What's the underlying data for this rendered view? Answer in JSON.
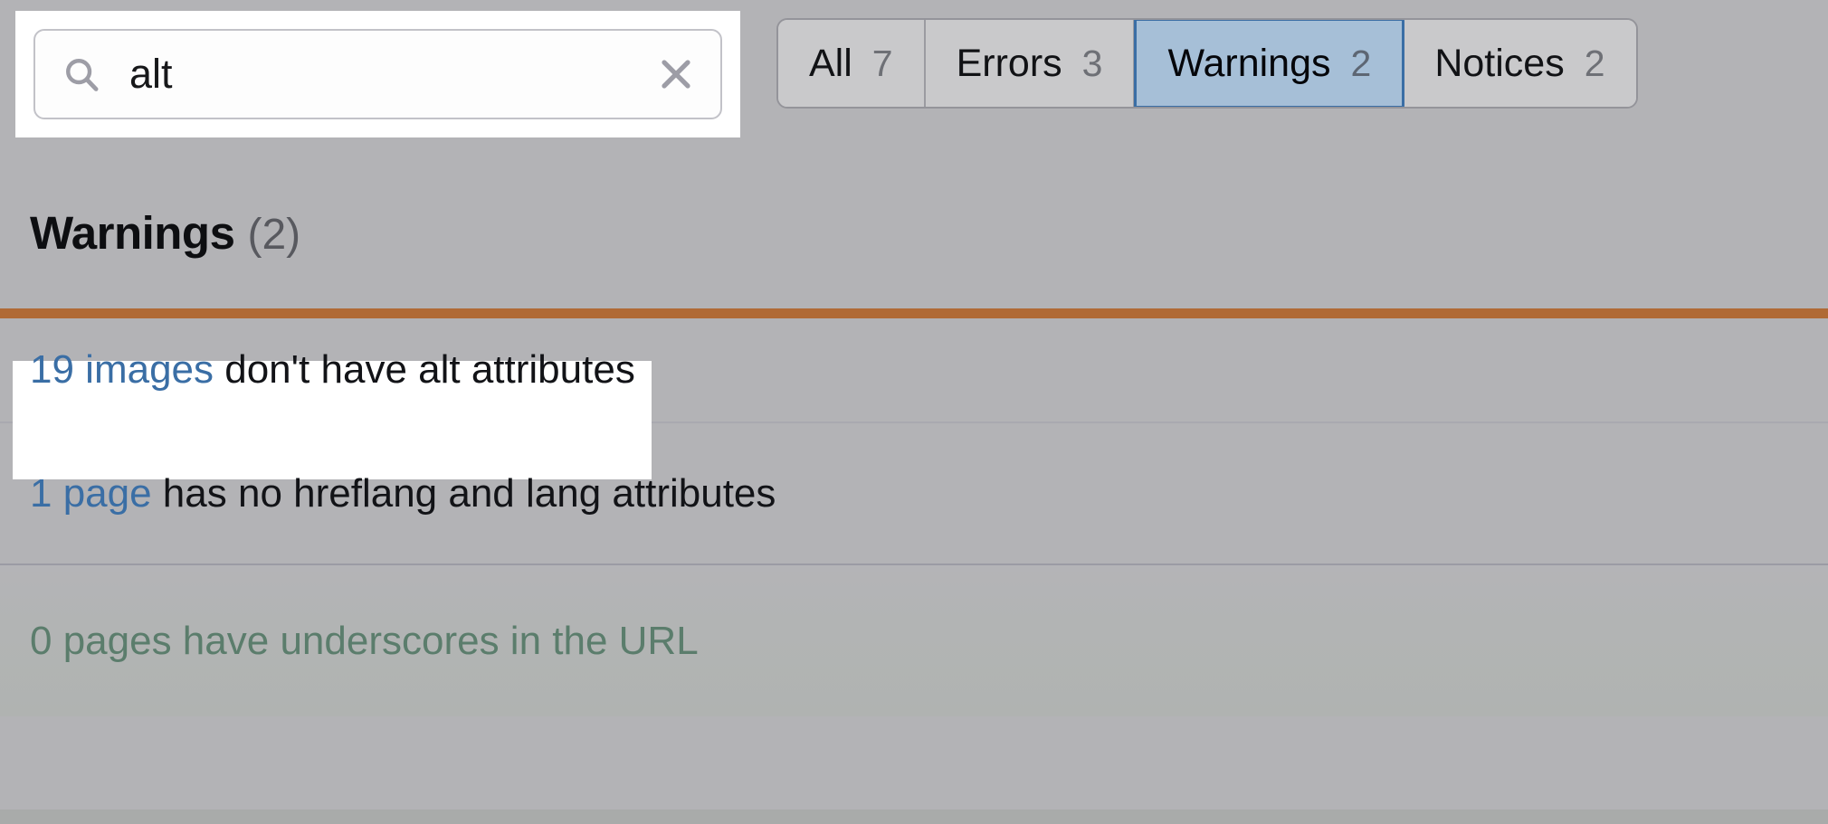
{
  "search": {
    "value": "alt",
    "placeholder": "Search",
    "search_icon": "search-icon",
    "clear_icon": "close-icon"
  },
  "filters": {
    "tabs": [
      {
        "label": "All",
        "count": "7",
        "selected": false
      },
      {
        "label": "Errors",
        "count": "3",
        "selected": false
      },
      {
        "label": "Warnings",
        "count": "2",
        "selected": true
      },
      {
        "label": "Notices",
        "count": "2",
        "selected": false
      }
    ]
  },
  "section": {
    "title": "Warnings",
    "count": "(2)",
    "severity_color": "#b06a36"
  },
  "issues": [
    {
      "link": "19 images",
      "text": " don't have alt attributes",
      "highlighted": true,
      "dimmed": false
    },
    {
      "link": "1 page",
      "text": " has no hreflang and lang attributes",
      "highlighted": false,
      "dimmed": false
    },
    {
      "link": "0 pages",
      "text": " have underscores in the URL",
      "highlighted": false,
      "dimmed": true
    }
  ],
  "colors": {
    "background": "#b3b3b6",
    "link": "#3a6ea5",
    "selected_tab_fill": "#a6bfd7",
    "selected_tab_border": "#3a6ea5",
    "dimmed_text": "#5b7d6c"
  }
}
